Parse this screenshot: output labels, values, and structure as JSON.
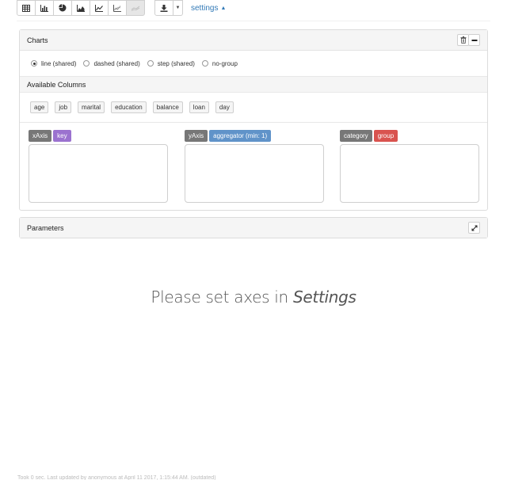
{
  "toolbar": {
    "chart_buttons": [
      {
        "icon": "table-icon",
        "active": false
      },
      {
        "icon": "bar-chart-icon",
        "active": false
      },
      {
        "icon": "pie-chart-icon",
        "active": false
      },
      {
        "icon": "area-chart-icon",
        "active": false
      },
      {
        "icon": "line-chart-icon",
        "active": false
      },
      {
        "icon": "scatter-chart-icon",
        "active": false
      },
      {
        "icon": "multi-line-chart-icon",
        "active": true
      }
    ],
    "download_icon": "download-icon",
    "settings_label": "settings"
  },
  "charts_panel": {
    "title": "Charts",
    "radios": [
      {
        "label": "line (shared)",
        "checked": true
      },
      {
        "label": "dashed (shared)",
        "checked": false
      },
      {
        "label": "step (shared)",
        "checked": false
      },
      {
        "label": "no-group",
        "checked": false
      }
    ],
    "available_columns_title": "Available Columns",
    "columns": [
      "age",
      "job",
      "marital",
      "education",
      "balance",
      "loan",
      "day"
    ],
    "axes": {
      "x": {
        "label": "xAxis",
        "tag": "key"
      },
      "y": {
        "label": "yAxis",
        "tag": "aggregator (min: 1)"
      },
      "category": {
        "label": "category",
        "tag": "group"
      }
    }
  },
  "parameters_panel": {
    "title": "Parameters"
  },
  "message": {
    "prefix": "Please set axes in ",
    "emphasis": "Settings"
  },
  "footer_text": "Took 0 sec. Last updated by anonymous at April 11 2017, 1:15:44 AM. (outdated)"
}
